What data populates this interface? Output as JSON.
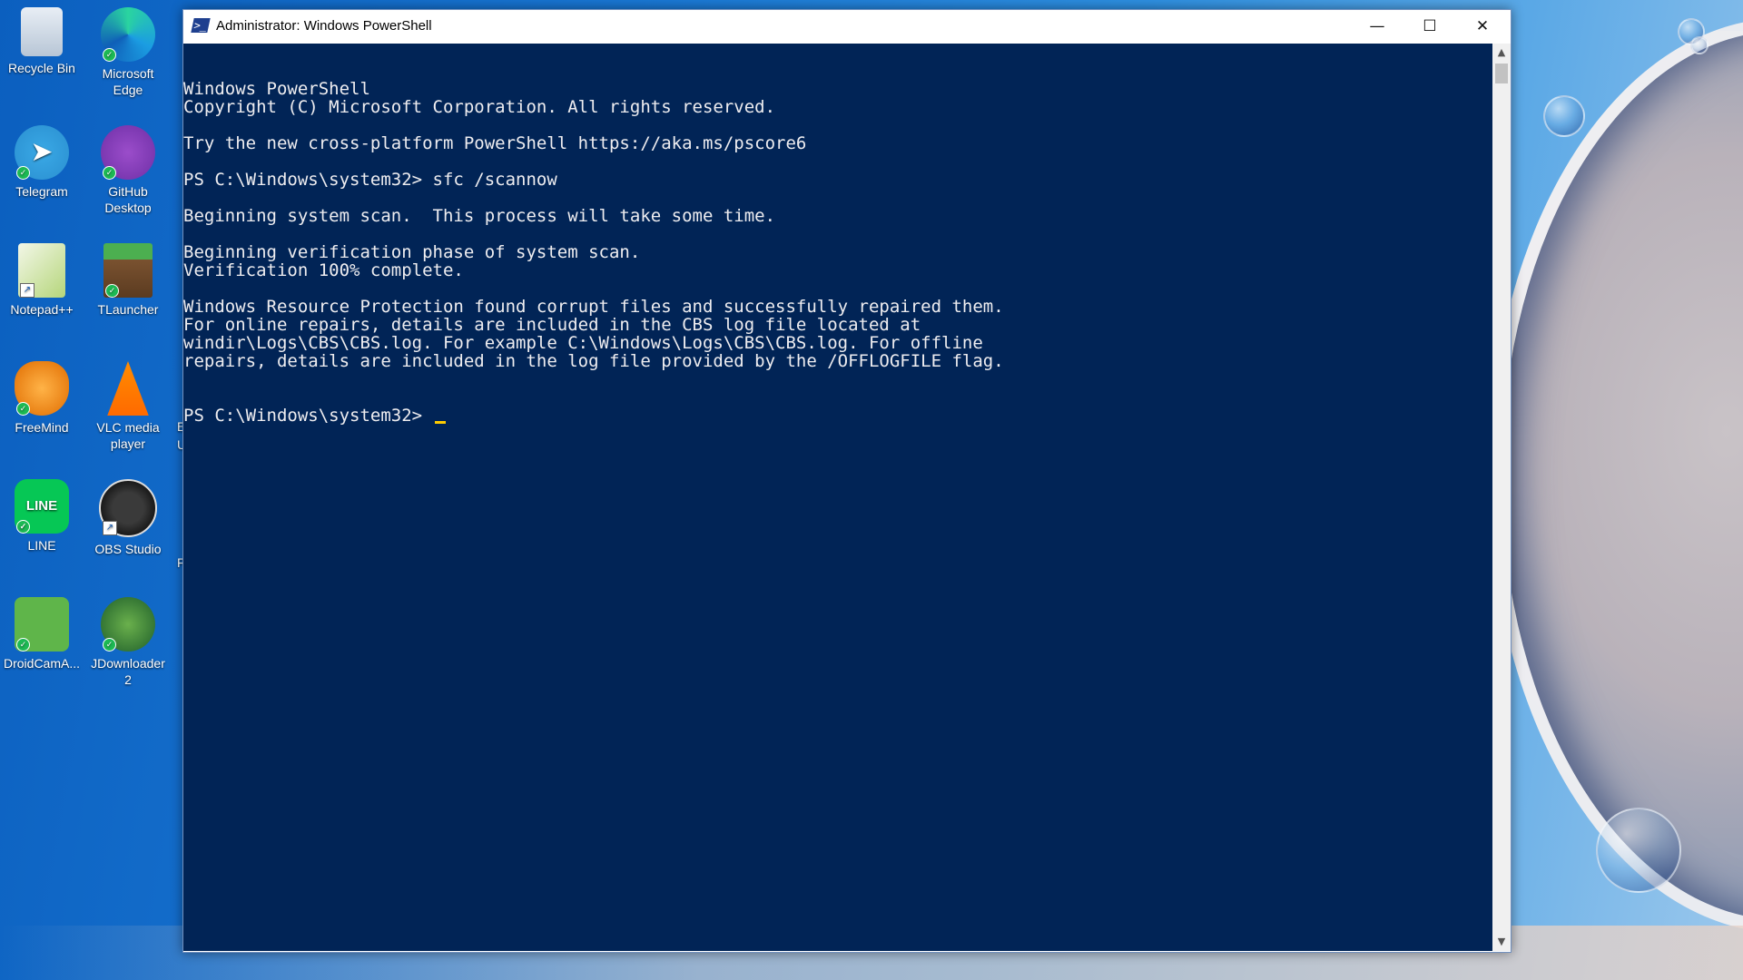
{
  "desktop": {
    "icons": [
      {
        "label": "Recycle Bin",
        "icon": "recycle-bin-icon"
      },
      {
        "label": "Microsoft Edge",
        "icon": "edge-icon"
      },
      {
        "label": "Telegram",
        "icon": "telegram-icon"
      },
      {
        "label": "GitHub Desktop",
        "icon": "github-icon"
      },
      {
        "label": "Notepad++",
        "icon": "notepad-plus-icon"
      },
      {
        "label": "TLauncher",
        "icon": "tlauncher-icon"
      },
      {
        "label": "FreeMind",
        "icon": "freemind-icon"
      },
      {
        "label": "VLC media player",
        "icon": "vlc-icon"
      },
      {
        "label": "LINE",
        "icon": "line-icon"
      },
      {
        "label": "OBS Studio",
        "icon": "obs-icon"
      },
      {
        "label": "DroidCamA...",
        "icon": "droidcam-icon"
      },
      {
        "label": "JDownloader 2",
        "icon": "jdownloader-icon"
      }
    ],
    "partial_labels": [
      "E",
      "U",
      "F"
    ]
  },
  "window": {
    "title": "Administrator: Windows PowerShell",
    "minimize_glyph": "—",
    "maximize_glyph": "☐",
    "close_glyph": "✕"
  },
  "console": {
    "lines": [
      "Windows PowerShell",
      "Copyright (C) Microsoft Corporation. All rights reserved.",
      "",
      "Try the new cross-platform PowerShell https://aka.ms/pscore6",
      "",
      "PS C:\\Windows\\system32> sfc /scannow",
      "",
      "Beginning system scan.  This process will take some time.",
      "",
      "Beginning verification phase of system scan.",
      "Verification 100% complete.",
      "",
      "Windows Resource Protection found corrupt files and successfully repaired them.",
      "For online repairs, details are included in the CBS log file located at",
      "windir\\Logs\\CBS\\CBS.log. For example C:\\Windows\\Logs\\CBS\\CBS.log. For offline",
      "repairs, details are included in the log file provided by the /OFFLOGFILE flag."
    ],
    "prompt": "PS C:\\Windows\\system32> ",
    "background_color": "#012456",
    "text_color": "#eeedf0",
    "cursor_color": "#ffcc00"
  },
  "scrollbar": {
    "up_glyph": "▲",
    "down_glyph": "▼"
  }
}
